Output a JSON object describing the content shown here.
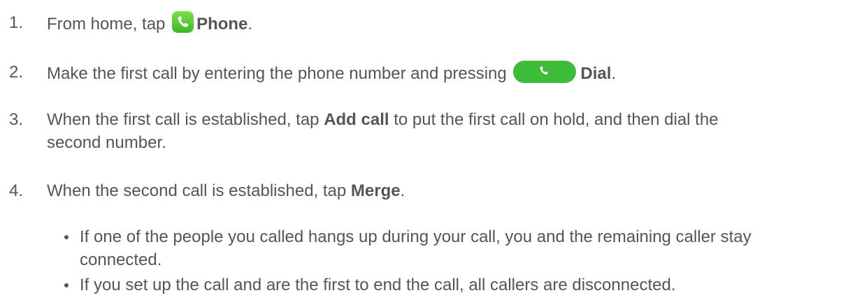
{
  "steps": [
    {
      "number": "1.",
      "pre": "From home, tap ",
      "icon": "phone-app-icon",
      "bold": "Phone",
      "post": "."
    },
    {
      "number": "2.",
      "pre": "Make the first call by entering the phone number and pressing ",
      "icon": "dial-button-icon",
      "bold": "Dial",
      "post": "."
    },
    {
      "number": "3.",
      "pre": "When the first call is established, tap ",
      "bold": "Add call",
      "post": " to put the first call on hold, and then dial the",
      "post2": "second number."
    },
    {
      "number": "4.",
      "pre": "When the second call is established, tap ",
      "bold": "Merge",
      "post": "."
    }
  ],
  "bullets": [
    {
      "line1": "If one of the people you called hangs up during your call, you and the remaining caller stay",
      "line2": "connected."
    },
    {
      "line1": "If you set up the call and are the first to end the call, all callers are disconnected."
    }
  ],
  "colors": {
    "text": "#555555",
    "phone_icon": "#4cc63a",
    "dial_button": "#3ebd3a"
  }
}
